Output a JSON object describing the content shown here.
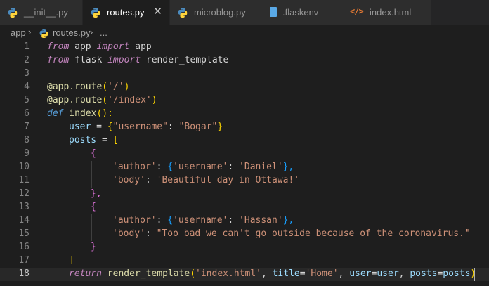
{
  "tabs": [
    {
      "label": "__init__.py",
      "icon": "python-icon",
      "active": false
    },
    {
      "label": "routes.py",
      "icon": "python-icon",
      "active": true,
      "close": "✕"
    },
    {
      "label": "microblog.py",
      "icon": "python-icon",
      "active": false
    },
    {
      "label": ".flaskenv",
      "icon": "env-file-icon",
      "active": false
    },
    {
      "label": "index.html",
      "icon": "html-icon",
      "glyph": "</>",
      "active": false
    }
  ],
  "breadcrumb": {
    "root": "app",
    "sep": "›",
    "file": "routes.py",
    "more": "..."
  },
  "editor": {
    "current_line": 18,
    "lines": [
      {
        "n": "1"
      },
      {
        "n": "2"
      },
      {
        "n": "3"
      },
      {
        "n": "4"
      },
      {
        "n": "5"
      },
      {
        "n": "6"
      },
      {
        "n": "7"
      },
      {
        "n": "8"
      },
      {
        "n": "9"
      },
      {
        "n": "10"
      },
      {
        "n": "11"
      },
      {
        "n": "12"
      },
      {
        "n": "13"
      },
      {
        "n": "14"
      },
      {
        "n": "15"
      },
      {
        "n": "16"
      },
      {
        "n": "17"
      },
      {
        "n": "18"
      }
    ],
    "code": {
      "l1": [
        "from",
        " app ",
        "import",
        " app"
      ],
      "l2": [
        "from",
        " flask ",
        "import",
        " render_template"
      ],
      "l4": [
        "@app.route",
        "(",
        "'/'",
        ")"
      ],
      "l5": [
        "@app.route",
        "(",
        "'/index'",
        ")"
      ],
      "l6": [
        "def",
        " ",
        "index",
        "():"
      ],
      "l7": [
        "user",
        " = ",
        "{",
        "\"username\"",
        ": ",
        "\"Bogar\"",
        "}"
      ],
      "l8": [
        "posts",
        " = ",
        "["
      ],
      "l9": [
        "{"
      ],
      "l10": [
        "'author'",
        ": ",
        "{",
        "'username'",
        ": ",
        "'Daniel'",
        "},"
      ],
      "l11": [
        "'body'",
        ": ",
        "'Beautiful day in Ottawa!'"
      ],
      "l12": [
        "},"
      ],
      "l13": [
        "{"
      ],
      "l14": [
        "'author'",
        ": ",
        "{",
        "'username'",
        ": ",
        "'Hassan'",
        "},"
      ],
      "l15": [
        "'body'",
        ": ",
        "\"Too bad we can't go outside because of the coronavirus.\""
      ],
      "l16": [
        "}"
      ],
      "l17": [
        "]"
      ],
      "l18": [
        "return",
        " ",
        "render_template",
        "(",
        "'index.html'",
        ", ",
        "title",
        "=",
        "'Home'",
        ", ",
        "user",
        "=",
        "user",
        ", ",
        "posts",
        "=",
        "posts",
        ")"
      ]
    }
  }
}
